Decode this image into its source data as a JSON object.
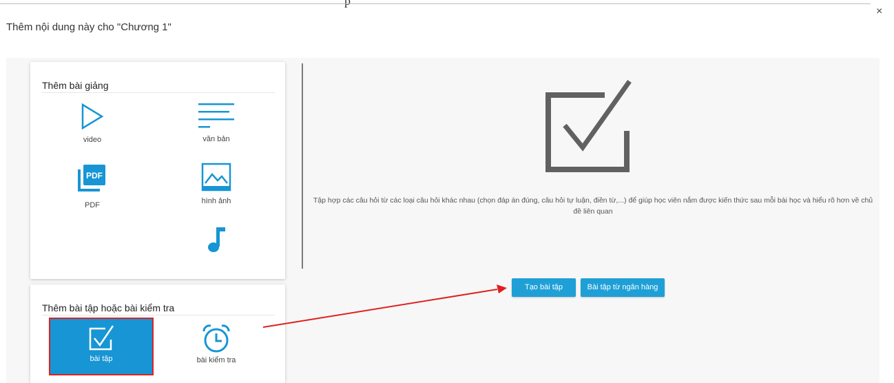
{
  "dialog": {
    "title": "Thêm nội dung này cho \"Chương 1\"",
    "close_symbol": "×",
    "top_fragment": "p"
  },
  "lectures": {
    "title": "Thêm bài giảng",
    "items": [
      {
        "label": "video",
        "icon": "play-icon"
      },
      {
        "label": "văn bản",
        "icon": "text-lines-icon"
      },
      {
        "label": "PDF",
        "icon": "pdf-icon",
        "icon_text": "PDF"
      },
      {
        "label": "hình ảnh",
        "icon": "image-icon"
      },
      {
        "label": "",
        "icon": "music-note-icon"
      }
    ]
  },
  "exercises": {
    "title": "Thêm bài tập hoặc bài kiểm tra",
    "items": [
      {
        "label": "bài tập",
        "icon": "checkbox-icon",
        "selected": true
      },
      {
        "label": "bài kiểm tra",
        "icon": "alarm-clock-icon"
      }
    ]
  },
  "detail": {
    "description": "Tập hợp các câu hỏi từ các loại câu hỏi khác nhau (chọn đáp án đúng, câu hỏi tự luận, điền từ,...) để giúp học viên nắm được kiến thức sau mỗi bài học và hiểu rõ hơn về chủ đề liên quan",
    "create_button": "Tạo bài tập",
    "bank_button": "Bài tập từ ngân hàng"
  },
  "colors": {
    "accent": "#1ea0d6",
    "icon_blue": "#1795d4",
    "highlight_border": "#e02020",
    "annotation_arrow": "#e02020"
  }
}
